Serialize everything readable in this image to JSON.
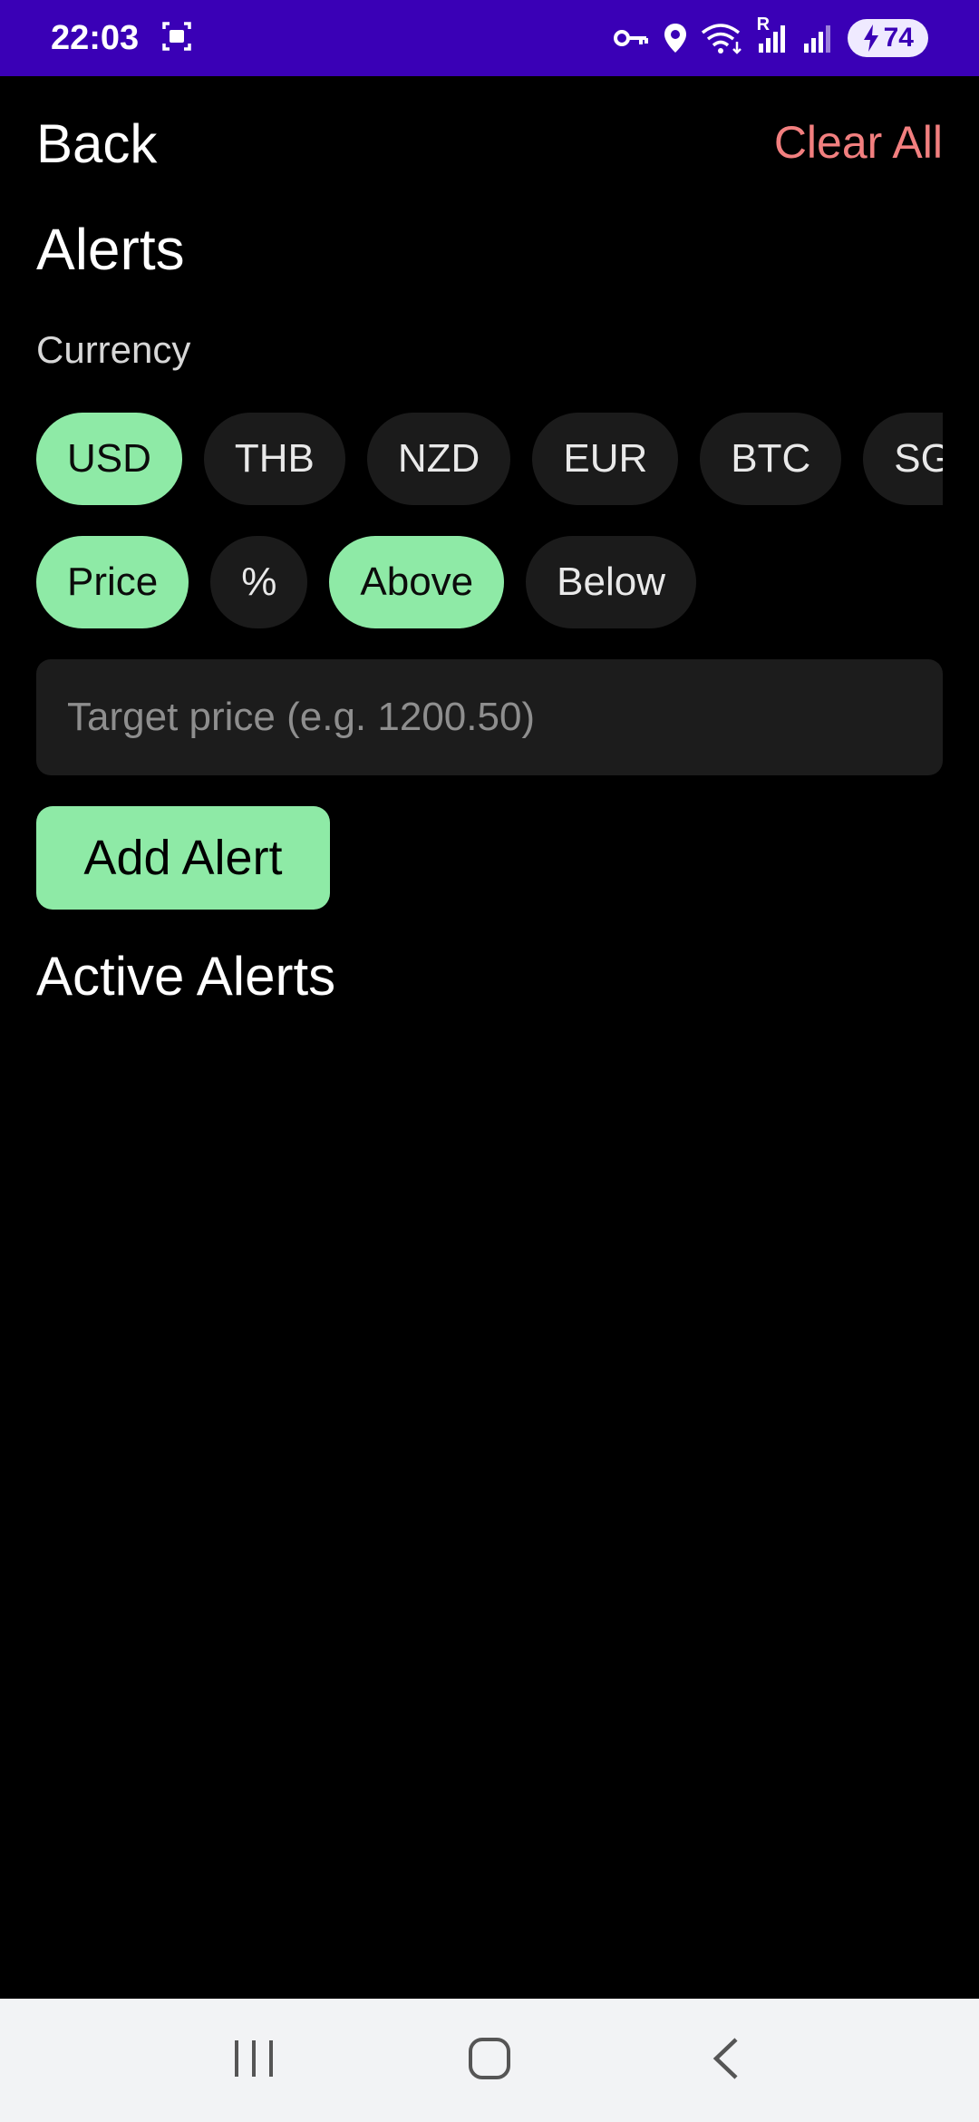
{
  "status_bar": {
    "time": "22:03",
    "wifi_badge": "R",
    "battery": "74"
  },
  "header": {
    "back_label": "Back",
    "clear_all_label": "Clear All"
  },
  "page": {
    "title": "Alerts",
    "currency_label": "Currency"
  },
  "currencies": [
    {
      "label": "USD",
      "selected": true
    },
    {
      "label": "THB",
      "selected": false
    },
    {
      "label": "NZD",
      "selected": false
    },
    {
      "label": "EUR",
      "selected": false
    },
    {
      "label": "BTC",
      "selected": false
    },
    {
      "label": "SGD",
      "selected": false
    }
  ],
  "alert_type": [
    {
      "label": "Price",
      "selected": true
    },
    {
      "label": "%",
      "selected": false
    }
  ],
  "direction": [
    {
      "label": "Above",
      "selected": true
    },
    {
      "label": "Below",
      "selected": false
    }
  ],
  "target_input": {
    "placeholder": "Target price (e.g. 1200.50)",
    "value": ""
  },
  "add_alert_label": "Add Alert",
  "active_alerts": {
    "title": "Active Alerts",
    "items": []
  },
  "colors": {
    "status_bar": "#3a00b6",
    "accent_green": "#8eeaa6",
    "clear_red": "#f27f7f",
    "chip_bg": "#1b1b1b"
  }
}
